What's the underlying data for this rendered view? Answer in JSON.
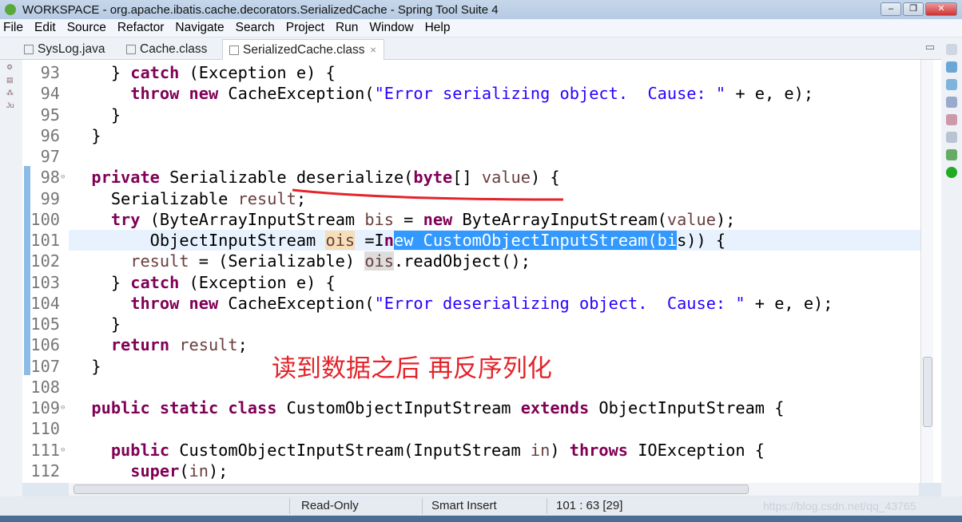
{
  "window": {
    "title": "WORKSPACE - org.apache.ibatis.cache.decorators.SerializedCache - Spring Tool Suite 4",
    "controls": [
      "minimize",
      "restore",
      "close"
    ]
  },
  "menu": [
    "File",
    "Edit",
    "Source",
    "Refactor",
    "Navigate",
    "Search",
    "Project",
    "Run",
    "Window",
    "Help"
  ],
  "tabs": [
    {
      "label": "SysLog.java",
      "icon": "java-file-icon"
    },
    {
      "label": "Cache.class",
      "icon": "class-file-icon"
    },
    {
      "label": "SerializedCache.class",
      "icon": "class-file-icon",
      "active": true,
      "close": "⨯"
    }
  ],
  "editor": {
    "current_line": 101,
    "lines": [
      {
        "n": "93",
        "t": [
          [
            "p",
            "    } "
          ],
          [
            "kw",
            "catch"
          ],
          [
            "p",
            " (Exception e) {"
          ]
        ]
      },
      {
        "n": "94",
        "t": [
          [
            "p",
            "      "
          ],
          [
            "kw",
            "throw"
          ],
          [
            "p",
            " "
          ],
          [
            "kw",
            "new"
          ],
          [
            "p",
            " CacheException("
          ],
          [
            "str",
            "\"Error serializing object.  Cause: \""
          ],
          [
            "p",
            " + e, e);"
          ]
        ]
      },
      {
        "n": "95",
        "t": [
          [
            "p",
            "    }"
          ]
        ]
      },
      {
        "n": "96",
        "t": [
          [
            "p",
            "  }"
          ]
        ]
      },
      {
        "n": "97",
        "t": []
      },
      {
        "n": "98",
        "fold": true,
        "t": [
          [
            "p",
            "  "
          ],
          [
            "kw",
            "private"
          ],
          [
            "p",
            " Serializable deserialize("
          ],
          [
            "kw",
            "byte"
          ],
          [
            "p",
            "[] "
          ],
          [
            "var",
            "value"
          ],
          [
            "p",
            ") {"
          ]
        ]
      },
      {
        "n": "99",
        "t": [
          [
            "p",
            "    Serializable "
          ],
          [
            "var",
            "result"
          ],
          [
            "p",
            ";"
          ]
        ]
      },
      {
        "n": "100",
        "t": [
          [
            "p",
            "    "
          ],
          [
            "kw",
            "try"
          ],
          [
            "p",
            " (ByteArrayInputStream "
          ],
          [
            "var",
            "bis"
          ],
          [
            "p",
            " = "
          ],
          [
            "kw",
            "new"
          ],
          [
            "p",
            " ByteArrayInputStream("
          ],
          [
            "var",
            "value"
          ],
          [
            "p",
            ");"
          ]
        ]
      },
      {
        "n": "101",
        "t": [
          [
            "p",
            "        ObjectInputStream "
          ],
          [
            "occ",
            "ois"
          ],
          [
            "p",
            " ="
          ],
          [
            "p",
            "I"
          ],
          [
            "kw",
            "n"
          ],
          [
            "sel",
            "ew CustomObjectInputStream(bi"
          ],
          [
            "p",
            "s)) {"
          ]
        ]
      },
      {
        "n": "102",
        "t": [
          [
            "p",
            "      "
          ],
          [
            "var",
            "result"
          ],
          [
            "p",
            " = (Serializable) "
          ],
          [
            "occ2",
            "ois"
          ],
          [
            "p",
            ".readObject();"
          ]
        ]
      },
      {
        "n": "103",
        "t": [
          [
            "p",
            "    } "
          ],
          [
            "kw",
            "catch"
          ],
          [
            "p",
            " (Exception e) {"
          ]
        ]
      },
      {
        "n": "104",
        "t": [
          [
            "p",
            "      "
          ],
          [
            "kw",
            "throw"
          ],
          [
            "p",
            " "
          ],
          [
            "kw",
            "new"
          ],
          [
            "p",
            " CacheException("
          ],
          [
            "str",
            "\"Error deserializing object.  Cause: \""
          ],
          [
            "p",
            " + e, e);"
          ]
        ]
      },
      {
        "n": "105",
        "t": [
          [
            "p",
            "    }"
          ]
        ]
      },
      {
        "n": "106",
        "t": [
          [
            "p",
            "    "
          ],
          [
            "kw",
            "return"
          ],
          [
            "p",
            " "
          ],
          [
            "var",
            "result"
          ],
          [
            "p",
            ";"
          ]
        ]
      },
      {
        "n": "107",
        "t": [
          [
            "p",
            "  }"
          ]
        ]
      },
      {
        "n": "108",
        "t": []
      },
      {
        "n": "109",
        "fold": true,
        "t": [
          [
            "p",
            "  "
          ],
          [
            "kw",
            "public"
          ],
          [
            "p",
            " "
          ],
          [
            "kw",
            "static"
          ],
          [
            "p",
            " "
          ],
          [
            "kw",
            "class"
          ],
          [
            "p",
            " CustomObjectInputStream "
          ],
          [
            "kw",
            "extends"
          ],
          [
            "p",
            " ObjectInputStream {"
          ]
        ]
      },
      {
        "n": "110",
        "t": []
      },
      {
        "n": "111",
        "fold": true,
        "t": [
          [
            "p",
            "    "
          ],
          [
            "kw",
            "public"
          ],
          [
            "p",
            " CustomObjectInputStream(InputStream "
          ],
          [
            "var",
            "in"
          ],
          [
            "p",
            ") "
          ],
          [
            "kw",
            "throws"
          ],
          [
            "p",
            " IOException {"
          ]
        ]
      },
      {
        "n": "112",
        "t": [
          [
            "p",
            "      "
          ],
          [
            "kw",
            "super"
          ],
          [
            "p",
            "("
          ],
          [
            "var",
            "in"
          ],
          [
            "p",
            ");"
          ]
        ]
      }
    ]
  },
  "annotation": {
    "text": "读到数据之后 再反序列化",
    "color": "#e3242b"
  },
  "status": {
    "mode": "Read-Only",
    "insert": "Smart Insert",
    "position": "101 : 63 [29]"
  },
  "watermark": "https://blog.csdn.net/qq_43765"
}
